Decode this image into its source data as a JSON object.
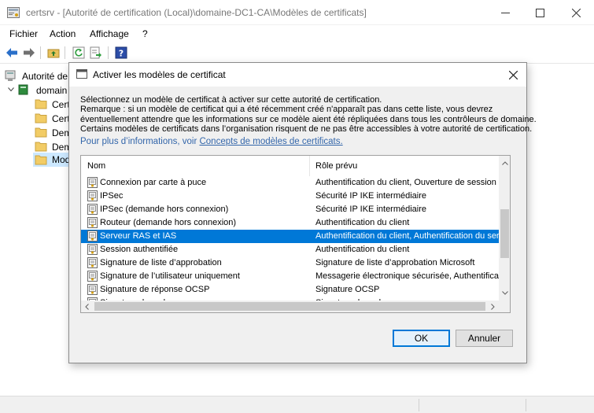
{
  "window": {
    "title": "certsrv - [Autorité de certification (Local)\\domaine-DC1-CA\\Modèles de certificats]",
    "minimize_icon": "minimize-icon",
    "maximize_icon": "maximize-icon",
    "close_icon": "close-icon"
  },
  "menu": [
    "Fichier",
    "Action",
    "Affichage",
    "?"
  ],
  "tree": {
    "root": "Autorité de",
    "domain": "domain",
    "items": [
      "Certi",
      "Certi",
      "Dem",
      "Dem",
      "Mod"
    ]
  },
  "dialog": {
    "title": "Activer les modèles de certificat",
    "description": [
      "Sélectionnez un modèle de certificat à activer sur cette autorité de certification.",
      "Remarque : si un modèle de certificat qui a été récemment créé n'apparaît pas dans cette liste, vous devrez",
      "éventuellement attendre que les informations sur ce modèle aient été répliquées dans tous les contrôleurs de domaine.",
      "Certains modèles de certificats dans l’organisation risquent de ne pas être accessibles à votre autorité de certification."
    ],
    "more_info_prefix": "Pour plus d’informations, voir ",
    "more_info_link": "Concepts de modèles de certificats.",
    "columns": [
      "Nom",
      "Rôle prévu"
    ],
    "rows": [
      {
        "name": "Connexion par carte à puce",
        "role": "Authentification du client, Ouverture de session p"
      },
      {
        "name": "IPSec",
        "role": "Sécurité IP IKE intermédiaire"
      },
      {
        "name": "IPSec (demande hors connexion)",
        "role": "Sécurité IP IKE intermédiaire"
      },
      {
        "name": "Routeur (demande hors connexion)",
        "role": "Authentification du client"
      },
      {
        "name": "Serveur RAS et IAS",
        "role": "Authentification du client, Authentification du serv",
        "selected": true
      },
      {
        "name": "Session authentifiée",
        "role": "Authentification du client"
      },
      {
        "name": "Signature de liste d’approbation",
        "role": "Signature de liste d’approbation Microsoft"
      },
      {
        "name": "Signature de l’utilisateur uniquement",
        "role": "Messagerie électronique sécurisée, Authentificati"
      },
      {
        "name": "Signature de réponse OCSP",
        "role": "Signature OCSP"
      },
      {
        "name": "Signature de code",
        "role": "Signature du code"
      }
    ],
    "ok_label": "OK",
    "cancel_label": "Annuler"
  },
  "colors": {
    "selection": "#0078d7",
    "link": "#3366aa",
    "dialog_bg": "#f0f0f0"
  }
}
